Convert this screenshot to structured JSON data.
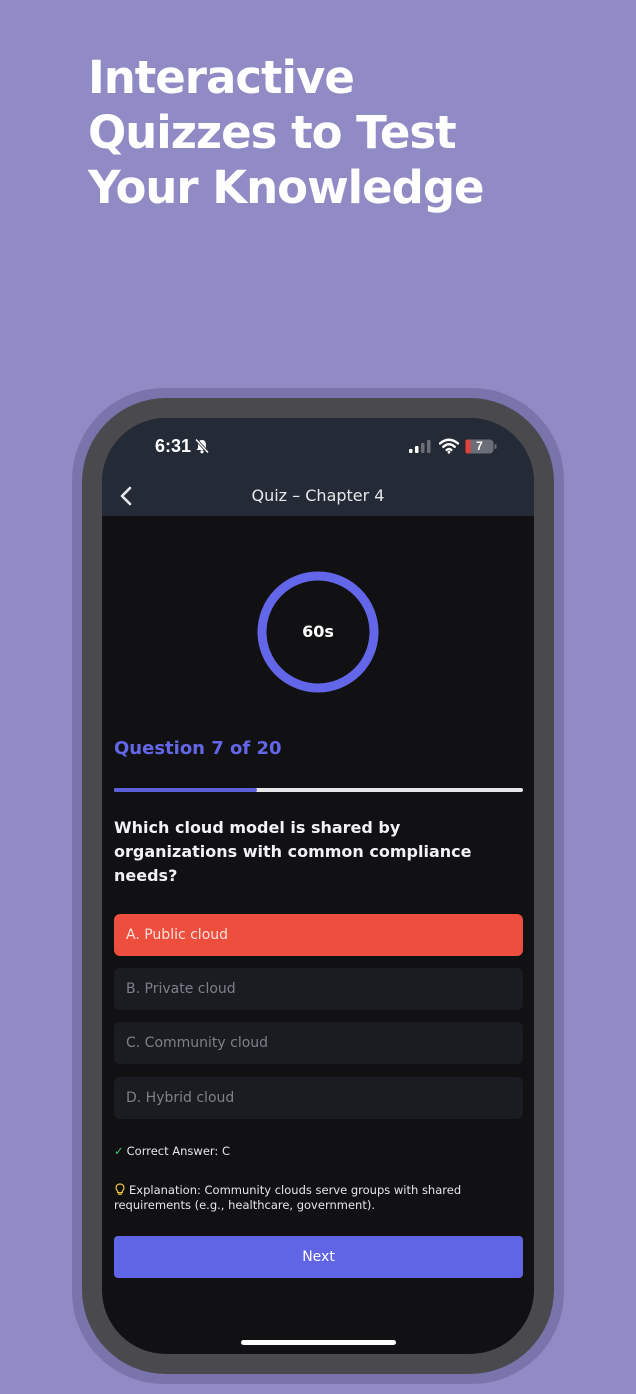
{
  "promo": {
    "headline_lines": [
      "Interactive",
      "Quizzes to Test",
      "Your Knowledge"
    ]
  },
  "status_bar": {
    "time": "6:31",
    "battery": "7",
    "icons": [
      "bell-slash-icon",
      "signal-icon",
      "wifi-icon",
      "battery-icon"
    ]
  },
  "nav": {
    "back_icon": "chevron-left-icon",
    "title": "Quiz – Chapter 4"
  },
  "timer": {
    "label": "60s",
    "remaining_fraction": 1.0
  },
  "quiz": {
    "counter": "Question 7 of 20",
    "progress": 0.35,
    "question": "Which cloud model is shared by organizations with common compliance needs?",
    "options": [
      {
        "label": "A. Public cloud",
        "state": "selected-wrong"
      },
      {
        "label": "B. Private cloud",
        "state": "default"
      },
      {
        "label": "C. Community cloud",
        "state": "default"
      },
      {
        "label": "D. Hybrid cloud",
        "state": "default"
      }
    ],
    "correct_answer": "Correct Answer: C",
    "explanation": "Explanation: Community clouds serve groups with shared requirements (e.g., healthcare, government).",
    "next_label": "Next"
  },
  "colors": {
    "background": "#908bc4",
    "accent": "#6065e6",
    "wrong": "#ed4e3d",
    "correct": "#41c56a"
  }
}
